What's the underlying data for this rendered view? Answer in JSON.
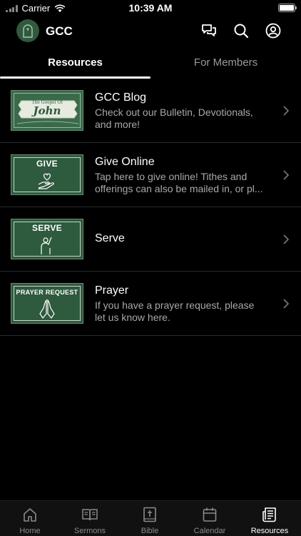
{
  "status": {
    "carrier": "Carrier",
    "time": "10:39 AM"
  },
  "header": {
    "title": "GCC"
  },
  "tabs": [
    {
      "label": "Resources"
    },
    {
      "label": "For Members"
    }
  ],
  "items": [
    {
      "title": "GCC Blog",
      "description": "Check out our Bulletin, Devotionals, and more!",
      "thumb_top": "The Gospel Of",
      "thumb_main": "John"
    },
    {
      "title": "Give Online",
      "description": "Tap here to give online! Tithes and offerings can also be mailed in, or pl...",
      "thumb_label": "GIVE"
    },
    {
      "title": "Serve",
      "description": "",
      "thumb_label": "SERVE"
    },
    {
      "title": "Prayer",
      "description": "If you have a prayer request, please let us know here.",
      "thumb_label": "PRAYER REQUEST"
    }
  ],
  "tabbar": [
    {
      "label": "Home",
      "icon": "home-icon"
    },
    {
      "label": "Sermons",
      "icon": "book-open-icon"
    },
    {
      "label": "Bible",
      "icon": "bible-icon"
    },
    {
      "label": "Calendar",
      "icon": "calendar-icon"
    },
    {
      "label": "Resources",
      "icon": "newspaper-icon",
      "active": true
    }
  ],
  "colors": {
    "brand_green": "#2e5a3d",
    "background": "#000000",
    "muted_text": "#a8a8a8"
  }
}
